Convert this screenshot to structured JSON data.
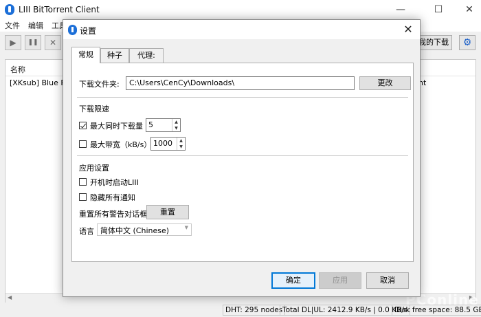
{
  "main_window": {
    "title": "LIII BitTorrent Client",
    "controls": {
      "minimize": "—",
      "maximize": "☐",
      "close": "✕"
    },
    "menu": [
      "文件",
      "编辑",
      "工具"
    ],
    "toolbar": {
      "play": "▶",
      "pause": "❚❚",
      "remove": "✕",
      "my_downloads": "我的下载",
      "settings_icon": "⚙"
    },
    "list": {
      "header_name": "名称",
      "rows": [
        {
          "name": "[XKsub] Blue Refle",
          "tail": "nt"
        }
      ]
    },
    "scroll": {
      "left": "◀",
      "right": "▶"
    },
    "status": {
      "dht": "DHT: 295 nodes",
      "total": "Total DL|UL: 2412.9 KB/s | 0.0 KB/s",
      "disk": "Disk free space: 88.5 GB"
    }
  },
  "dialog": {
    "title": "设置",
    "close": "✕",
    "tabs": [
      "常规",
      "种子",
      "代理:"
    ],
    "active_tab": "常规",
    "download_folder": {
      "label": "下载文件夹:",
      "value": "C:\\Users\\CenCy\\Downloads\\",
      "change_button": "更改"
    },
    "rate_limit": {
      "title": "下载限速",
      "max_downloads": {
        "label": "最大同时下载量",
        "value": "5",
        "checked": true
      },
      "max_bandwidth": {
        "label": "最大带宽（kB/s）",
        "value": "1000",
        "checked": false
      }
    },
    "app_settings": {
      "title": "应用设置",
      "start_on_boot": {
        "label": "开机时启动LIII",
        "checked": false
      },
      "hide_notifications": {
        "label": "隐藏所有通知",
        "checked": false
      },
      "reset_warnings": {
        "label": "重置所有警告对话框",
        "button": "重置"
      },
      "language": {
        "label": "语言",
        "value": "简体中文 (Chinese)"
      }
    },
    "buttons": {
      "ok": "确定",
      "apply": "应用",
      "cancel": "取消"
    }
  },
  "watermark": "PConline",
  "colors": {
    "accent": "#0078d7",
    "logo": "#1c6fd8",
    "dialog_bg": "#f0f0f0"
  }
}
